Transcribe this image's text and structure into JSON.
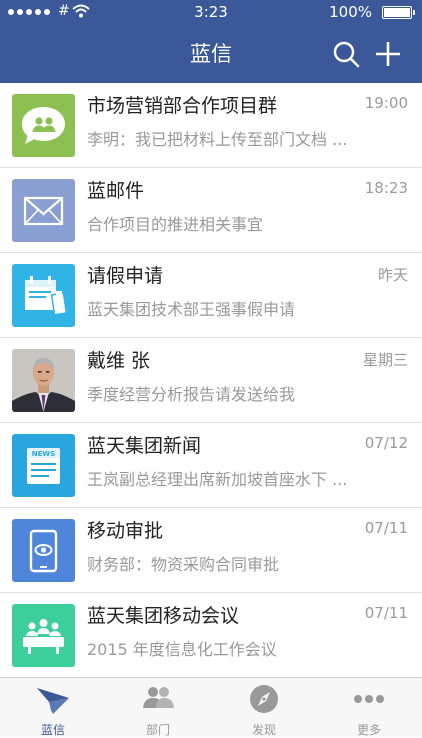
{
  "status_bar": {
    "carrier": "#",
    "time": "3:23",
    "battery": "100%"
  },
  "nav": {
    "title": "蓝信",
    "search_icon": "search-icon",
    "add_icon": "plus-icon"
  },
  "conversations": [
    {
      "title": "市场营销部合作项目群",
      "time": "19:00",
      "preview": "李明：我已把材料上传至部门文档 ...",
      "icon": "group-chat-icon",
      "color": "#8cc152"
    },
    {
      "title": "蓝邮件",
      "time": "18:23",
      "preview": "合作项目的推进相关事宜",
      "icon": "mail-icon",
      "color": "#8a9fd1"
    },
    {
      "title": "请假申请",
      "time": "昨天",
      "preview": "蓝天集团技术部王强事假申请",
      "icon": "calendar-leave-icon",
      "color": "#30b4e6"
    },
    {
      "title": "戴维 张",
      "time": "星期三",
      "preview": "季度经营分析报告请发送给我",
      "icon": "user-avatar",
      "color": "#6b6f78"
    },
    {
      "title": "蓝天集团新闻",
      "time": "07/12",
      "preview": "王岚副总经理出席新加坡首座水下 ...",
      "icon": "news-icon",
      "color": "#2aa6df"
    },
    {
      "title": "移动审批",
      "time": "07/11",
      "preview": "财务部：物资采购合同审批",
      "icon": "mobile-approval-icon",
      "color": "#4f86d9"
    },
    {
      "title": "蓝天集团移动会议",
      "time": "07/11",
      "preview": "2015 年度信息化工作会议",
      "icon": "meeting-icon",
      "color": "#3ccf9b"
    }
  ],
  "tabs": [
    {
      "label": "蓝信",
      "icon": "paper-plane-icon",
      "active": true
    },
    {
      "label": "部门",
      "icon": "contacts-icon",
      "active": false
    },
    {
      "label": "发现",
      "icon": "compass-icon",
      "active": false
    },
    {
      "label": "更多",
      "icon": "more-icon",
      "active": false
    }
  ],
  "colors": {
    "header": "#3b5998",
    "active_tab": "#3b5998",
    "inactive_tab": "#999999"
  }
}
